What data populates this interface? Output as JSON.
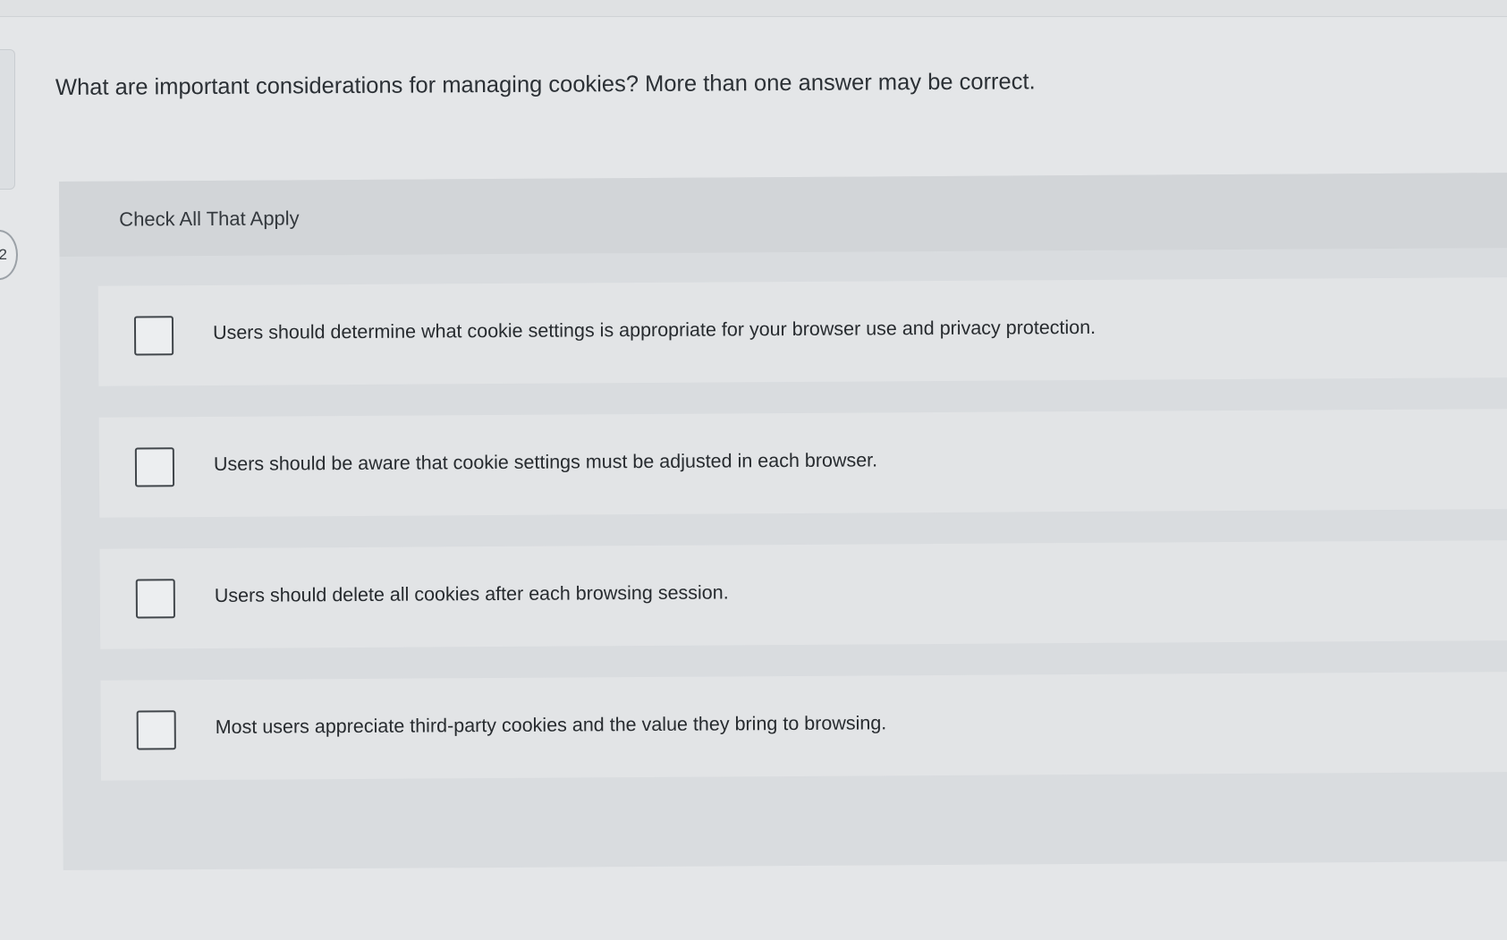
{
  "question": {
    "number": "2",
    "prompt": "What are important considerations for managing cookies? More than one answer may be correct."
  },
  "answers": {
    "instructions": "Check All That Apply",
    "options": [
      {
        "label": "Users should determine what cookie settings is appropriate for your browser use and privacy protection.",
        "checked": false
      },
      {
        "label": "Users should be aware that cookie settings must be adjusted in each browser.",
        "checked": false
      },
      {
        "label": "Users should delete all cookies after each browsing session.",
        "checked": false
      },
      {
        "label": "Most users appreciate third-party cookies and the value they bring to browsing.",
        "checked": false
      }
    ]
  }
}
